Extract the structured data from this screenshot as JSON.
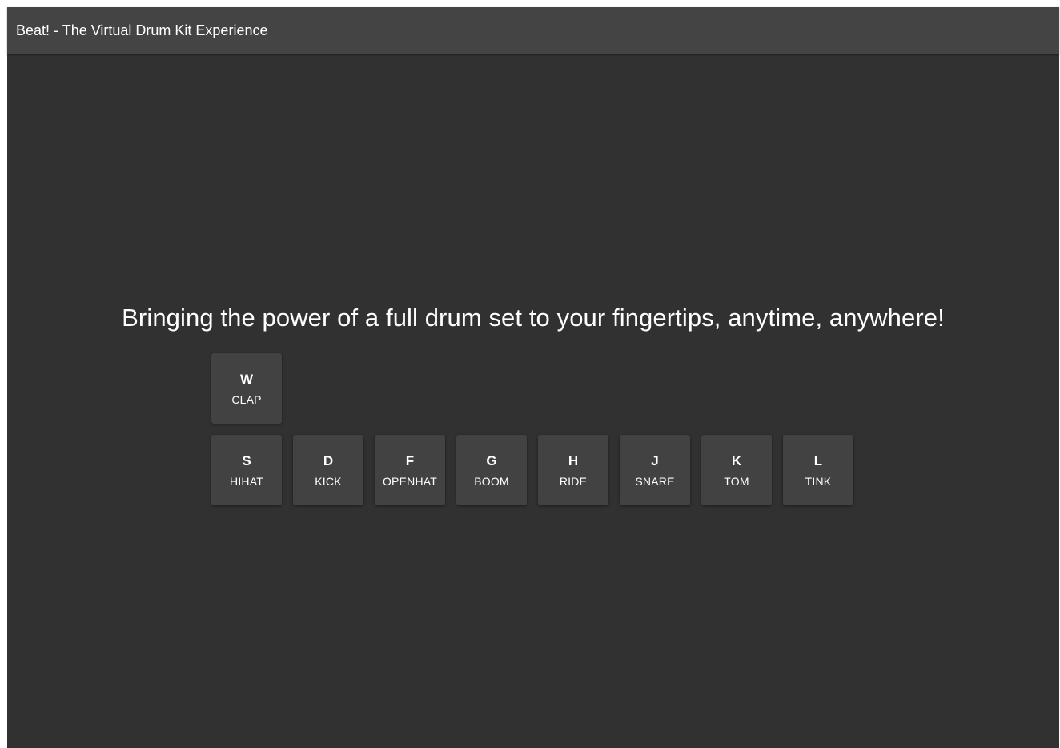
{
  "header": {
    "title": "Beat! - The Virtual Drum Kit Experience"
  },
  "main": {
    "tagline": "Bringing the power of a full drum set to your fingertips, anytime, anywhere!"
  },
  "keys_top": [
    {
      "key": "W",
      "sound": "CLAP"
    }
  ],
  "keys_bottom": [
    {
      "key": "S",
      "sound": "HIHAT"
    },
    {
      "key": "D",
      "sound": "KICK"
    },
    {
      "key": "F",
      "sound": "OPENHAT"
    },
    {
      "key": "G",
      "sound": "BOOM"
    },
    {
      "key": "H",
      "sound": "RIDE"
    },
    {
      "key": "J",
      "sound": "SNARE"
    },
    {
      "key": "K",
      "sound": "TOM"
    },
    {
      "key": "L",
      "sound": "TINK"
    }
  ],
  "colors": {
    "background": "#313131",
    "header": "#444444",
    "key": "#424242",
    "text": "#ffffff"
  }
}
